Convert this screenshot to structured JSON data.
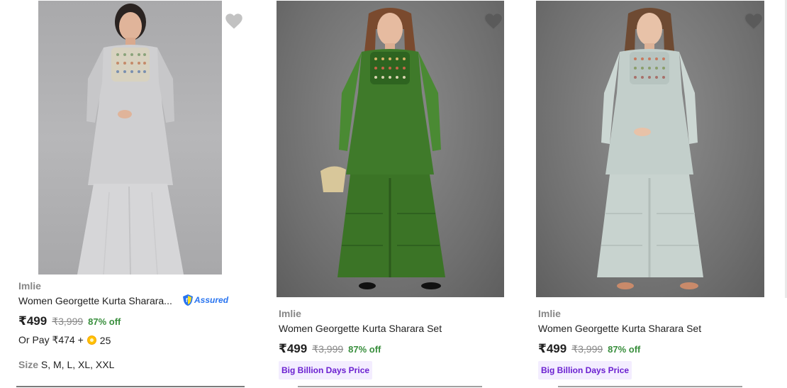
{
  "products": [
    {
      "brand": "Imlie",
      "title": "Women Georgette Kurta Sharara...",
      "price": "₹499",
      "mrp": "₹3,999",
      "discount": "87% off",
      "assured_label": "Assured",
      "pay_with": {
        "prefix": "Or Pay ₹474 +",
        "coins": "25"
      },
      "sizes": {
        "label": "Size",
        "values": "S, M, L, XL, XXL"
      },
      "image_icon": "product-photo-grey-kurta-sharara",
      "wishlist_icon": "heart-icon"
    },
    {
      "brand": "Imlie",
      "title": "Women Georgette Kurta Sharara Set",
      "price": "₹499",
      "mrp": "₹3,999",
      "discount": "87% off",
      "badge": "Big Billion Days Price",
      "image_icon": "product-photo-green-kurta-sharara",
      "wishlist_icon": "heart-icon"
    },
    {
      "brand": "Imlie",
      "title": "Women Georgette Kurta Sharara Set",
      "price": "₹499",
      "mrp": "₹3,999",
      "discount": "87% off",
      "badge": "Big Billion Days Price",
      "image_icon": "product-photo-mint-kurta-sharara",
      "wishlist_icon": "heart-icon"
    }
  ],
  "colors": {
    "price_green": "#388e3c",
    "muted_grey": "#878787",
    "badge_purple": "#6a1fd0",
    "assured_blue": "#2874f0"
  }
}
